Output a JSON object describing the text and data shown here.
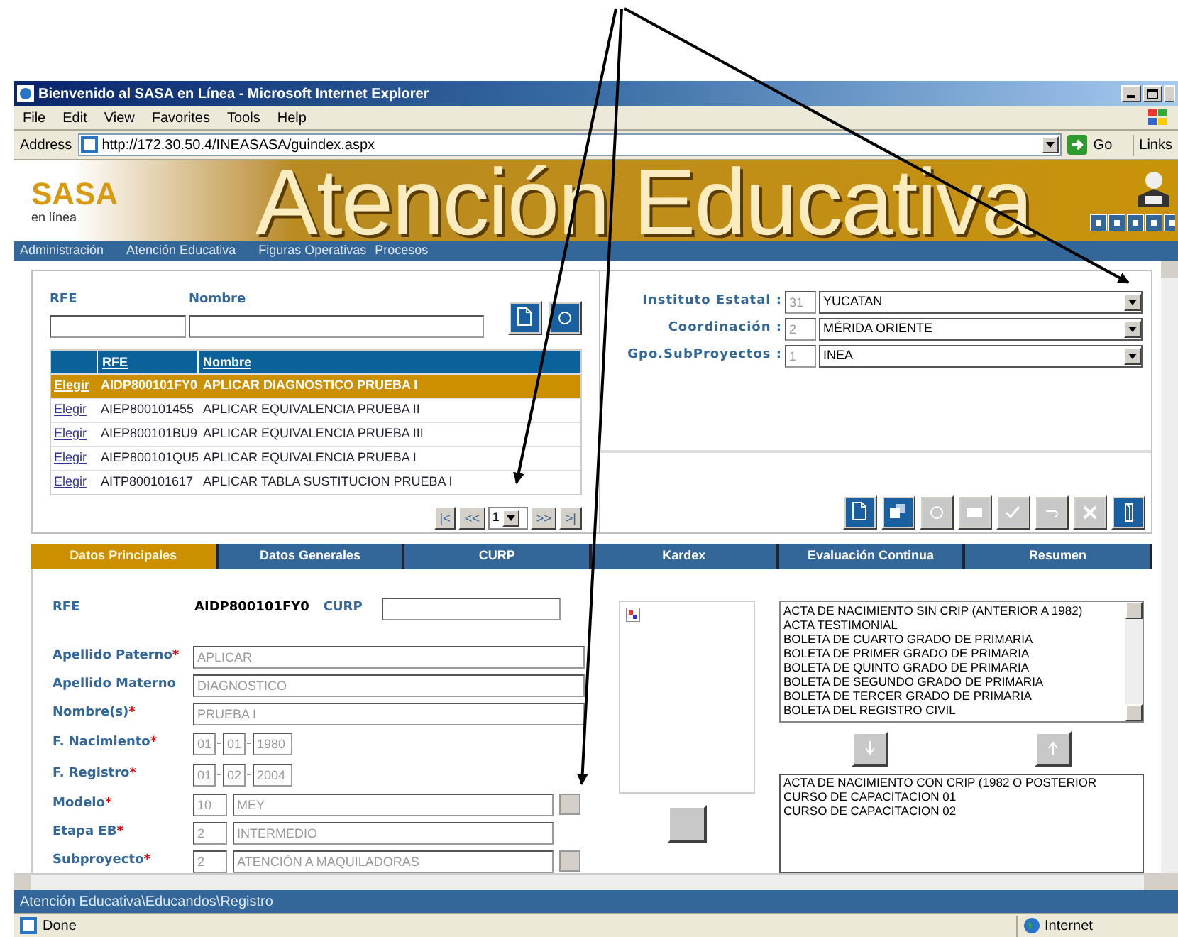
{
  "window": {
    "title": "Bienvenido al SASA en Línea - Microsoft Internet Explorer"
  },
  "menu": [
    "File",
    "Edit",
    "View",
    "Favorites",
    "Tools",
    "Help"
  ],
  "address": {
    "label": "Address",
    "url": "http://172.30.50.4/INEASASA/guindex.aspx",
    "go": "Go",
    "links": "Links"
  },
  "banner": {
    "logo": "SASA",
    "logo_sub": "en línea",
    "title": "Atención Educativa"
  },
  "nav": [
    "Administración",
    "Atención Educativa",
    "Figuras Operativas",
    "Procesos"
  ],
  "search": {
    "labels": [
      "RFE",
      "Nombre"
    ]
  },
  "results": {
    "columns": [
      "RFE",
      "Nombre"
    ],
    "rows": [
      {
        "link": "Elegir",
        "rfe": "AIDP800101FY0",
        "nombre": "APLICAR DIAGNOSTICO PRUEBA I",
        "selected": true
      },
      {
        "link": "Elegir",
        "rfe": "AIEP800101455",
        "nombre": "APLICAR EQUIVALENCIA PRUEBA II",
        "selected": false
      },
      {
        "link": "Elegir",
        "rfe": "AIEP800101BU9",
        "nombre": "APLICAR EQUIVALENCIA PRUEBA III",
        "selected": false
      },
      {
        "link": "Elegir",
        "rfe": "AIEP800101QU5",
        "nombre": "APLICAR EQUIVALENCIA PRUEBA I",
        "selected": false
      },
      {
        "link": "Elegir",
        "rfe": "AITP800101617",
        "nombre": "APLICAR TABLA SUSTITUCION PRUEBA I",
        "selected": false
      }
    ]
  },
  "pager": {
    "first": "|<",
    "prev": "<<",
    "page": "1",
    "next": ">>",
    "last": ">|"
  },
  "filters": [
    {
      "label": "Instituto Estatal :",
      "code": "31",
      "value": "YUCATAN"
    },
    {
      "label": "Coordinación :",
      "code": "2",
      "value": "MÉRIDA ORIENTE"
    },
    {
      "label": "Gpo.SubProyectos :",
      "code": "1",
      "value": "INEA"
    }
  ],
  "toolbar": [
    {
      "kind": "new",
      "disabled": false
    },
    {
      "kind": "copy",
      "disabled": false
    },
    {
      "kind": "refresh",
      "disabled": true
    },
    {
      "kind": "print",
      "disabled": true
    },
    {
      "kind": "check",
      "disabled": true
    },
    {
      "kind": "undo",
      "disabled": true
    },
    {
      "kind": "delete",
      "disabled": true
    },
    {
      "kind": "exit",
      "disabled": false
    }
  ],
  "tabs": [
    {
      "label": "Datos Principales",
      "selected": true
    },
    {
      "label": "Datos Generales",
      "selected": false
    },
    {
      "label": "CURP",
      "selected": false
    },
    {
      "label": "Kardex",
      "selected": false
    },
    {
      "label": "Evaluación Continua",
      "selected": false
    },
    {
      "label": "Resumen",
      "selected": false
    }
  ],
  "form": {
    "rfe_label": "RFE",
    "rfe_value": "AIDP800101FY0",
    "curp_label": "CURP",
    "fields": [
      {
        "kind": "text",
        "label": "Apellido Paterno",
        "mark": "*",
        "value": "APLICAR"
      },
      {
        "kind": "text",
        "label": "Apellido Materno",
        "value": "DIAGNOSTICO"
      },
      {
        "kind": "text",
        "label": "Nombre(s)",
        "mark": "*",
        "value": "PRUEBA I"
      },
      {
        "kind": "date",
        "label": "F. Nacimiento",
        "mark": "*",
        "parts": [
          "01",
          "01",
          "1980"
        ]
      },
      {
        "kind": "date",
        "label": "F. Registro",
        "mark": "*",
        "parts": [
          "01",
          "02",
          "2004"
        ]
      },
      {
        "kind": "code",
        "label": "Modelo",
        "mark": "*",
        "code": "10",
        "value": "MEY",
        "lookup": true
      },
      {
        "kind": "code",
        "label": "Etapa EB",
        "mark": "*",
        "code": "2",
        "value": "INTERMEDIO",
        "lookup": false
      },
      {
        "kind": "code",
        "label": "Subproyecto",
        "mark": "*",
        "code": "2",
        "value": "ATENCIÓN A MAQUILADORAS",
        "lookup": true
      }
    ]
  },
  "documents": {
    "available": [
      "ACTA DE NACIMIENTO SIN CRIP (ANTERIOR A 1982)",
      "ACTA TESTIMONIAL",
      "BOLETA DE CUARTO GRADO DE PRIMARIA",
      "BOLETA DE PRIMER GRADO DE PRIMARIA",
      "BOLETA DE QUINTO GRADO DE PRIMARIA",
      "BOLETA DE SEGUNDO GRADO DE PRIMARIA",
      "BOLETA DE TERCER GRADO DE PRIMARIA",
      "BOLETA DEL REGISTRO CIVIL"
    ],
    "chosen": [
      "ACTA DE NACIMIENTO CON CRIP (1982 O POSTERIOR",
      "CURSO DE CAPACITACION 01",
      "CURSO DE CAPACITACION 02"
    ]
  },
  "status_path": "Atención Educativa\\Educandos\\Registro",
  "status": {
    "text": "Done",
    "zone": "Internet"
  }
}
